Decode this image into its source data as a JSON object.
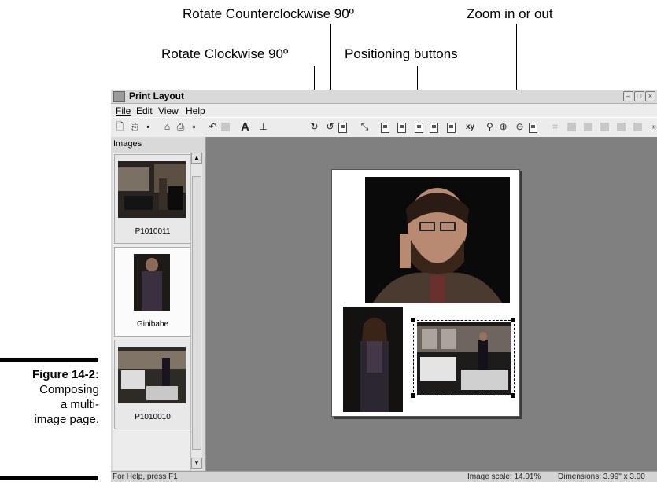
{
  "callouts": {
    "rotate_ccw": "Rotate Counterclockwise 90º",
    "zoom": "Zoom in or out",
    "rotate_cw": "Rotate Clockwise 90º",
    "positioning": "Positioning buttons"
  },
  "caption": {
    "figure": "Figure 14-2:",
    "line1": "Composing",
    "line2": "a multi-",
    "line3": "image page."
  },
  "window": {
    "title": "Print Layout",
    "menu": [
      "File",
      "Edit",
      "View",
      "Help"
    ]
  },
  "toolbar_icons": [
    "new-icon",
    "copy-icon",
    "save-icon",
    "open-icon",
    "print-icon",
    "preview-icon",
    "undo-icon",
    "color-icon",
    "text-icon",
    "stamp-icon",
    "rotate-clockwise-icon",
    "rotate-counterclockwise-icon",
    "fit-icon",
    "auto-arrange-icon",
    "position-center-icon",
    "position-top-left-icon",
    "position-bottom-left-icon",
    "position-bottom-right-icon",
    "position-top-right-icon",
    "xy-icon",
    "zoom-icon",
    "zoom-in-icon",
    "zoom-out-icon",
    "actual-size-icon",
    "grid-icon"
  ],
  "panel": {
    "label": "Images",
    "thumbnails": [
      {
        "name": "P1010011"
      },
      {
        "name": "Ginibabe"
      },
      {
        "name": "P1010010"
      }
    ]
  },
  "status": {
    "help": "For Help, press F1",
    "scale": "Image scale: 14.01%",
    "dimensions": "Dimensions: 3.99\" x 3.00"
  },
  "colors": {
    "workspace": "#808080",
    "page": "#ffffff",
    "chrome": "#ececec"
  }
}
